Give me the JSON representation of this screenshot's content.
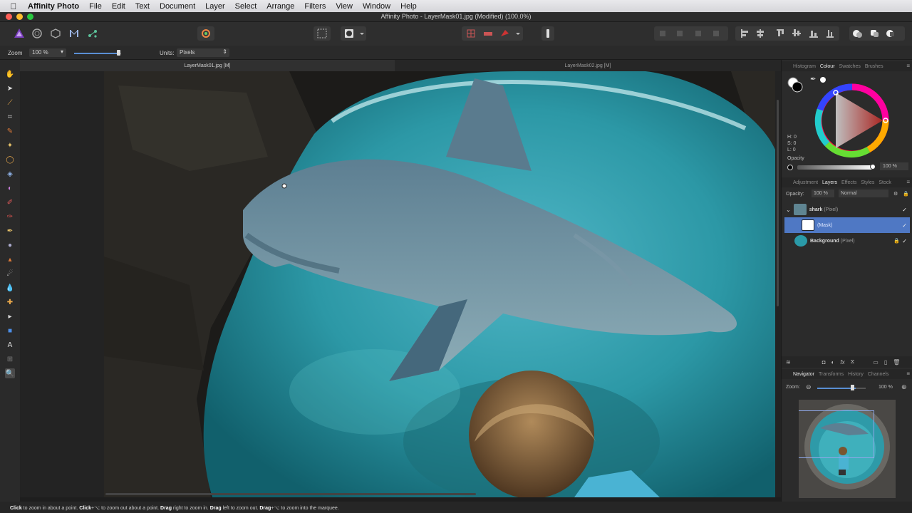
{
  "menubar": {
    "app_name": "Affinity Photo",
    "items": [
      "File",
      "Edit",
      "Text",
      "Document",
      "Layer",
      "Select",
      "Arrange",
      "Filters",
      "View",
      "Window",
      "Help"
    ]
  },
  "window": {
    "title": "Affinity Photo - LayerMask01.jpg (Modified) (100.0%)"
  },
  "context_toolbar": {
    "zoom_label": "Zoom",
    "zoom_value": "100 %",
    "zoom_slider_fraction": 0.95,
    "units_label": "Units:",
    "units_value": "Pixels"
  },
  "doc_tabs": [
    {
      "label": "LayerMask01.jpg [M]",
      "active": true
    },
    {
      "label": "LayerMask02.jpg [M]",
      "active": false
    }
  ],
  "colour_panel": {
    "tabs": [
      "Histogram",
      "Colour",
      "Swatches",
      "Brushes"
    ],
    "active_tab": "Colour",
    "hsl": {
      "h": "H: 0",
      "s": "S: 0",
      "l": "L: 0"
    },
    "opacity_label": "Opacity",
    "opacity_value": "100 %"
  },
  "layers_panel": {
    "tabs": [
      "Adjustment",
      "Layers",
      "Effects",
      "Styles",
      "Stock"
    ],
    "active_tab": "Layers",
    "opacity_label": "Opacity:",
    "opacity_value": "100 %",
    "blend_mode": "Normal",
    "layers": [
      {
        "name": "shark",
        "type": "(Pixel)"
      },
      {
        "name": "",
        "type": "(Mask)"
      },
      {
        "name": "Background",
        "type": "(Pixel)"
      }
    ]
  },
  "navigator_panel": {
    "tabs": [
      "Navigator",
      "Transforms",
      "History",
      "Channels"
    ],
    "active_tab": "Navigator",
    "zoom_label": "Zoom:",
    "zoom_value": "100 %",
    "zoom_slider_fraction": 0.78
  },
  "status": {
    "parts": [
      {
        "b": "Click",
        "t": " to zoom in about a point. "
      },
      {
        "b": "Click",
        "t": "+⌥ to zoom out about a point. "
      },
      {
        "b": "Drag",
        "t": " right to zoom in. "
      },
      {
        "b": "Drag",
        "t": " left to zoom out. "
      },
      {
        "b": "Drag",
        "t": "+⌥ to zoom into the marquee."
      }
    ]
  },
  "colors": {
    "accent": "#4f78c4",
    "affinity_purple": "#7b3fbf"
  }
}
